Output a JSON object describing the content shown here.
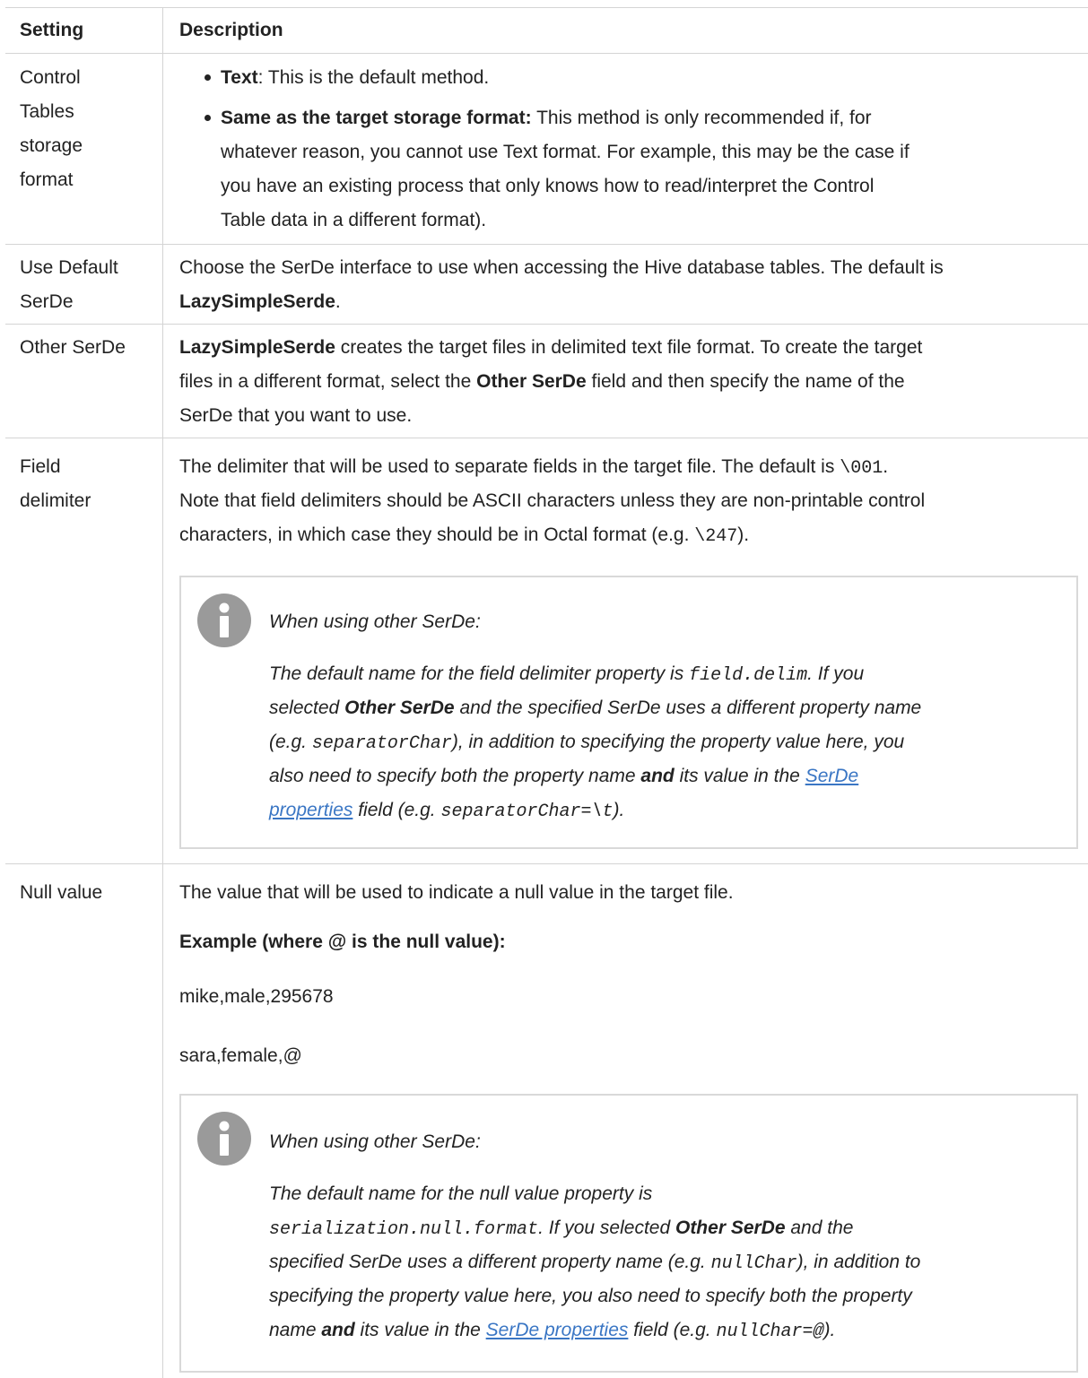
{
  "table": {
    "headers": {
      "setting": "Setting",
      "description": "Description"
    },
    "rows": {
      "control_tables": {
        "setting_lines": [
          "Control",
          "Tables",
          "storage",
          "format"
        ],
        "bullet1_bold": "Text",
        "bullet1_rest": ": This is the default method.",
        "bullet2_bold": "Same as the target storage format:",
        "bullet2_l1": " This method is only recommended if, for",
        "bullet2_l2": "whatever reason, you cannot use Text format. For example, this may be the case if",
        "bullet2_l3": "you have an existing process that only knows how to read/interpret the Control",
        "bullet2_l4": "Table data in a different format)."
      },
      "use_default_serde": {
        "setting_lines": [
          "Use Default",
          "SerDe"
        ],
        "line1": "Choose the SerDe interface to use when accessing the Hive database tables. The default is",
        "line2_bold": "LazySimpleSerde",
        "line2_rest": "."
      },
      "other_serde": {
        "setting": "Other SerDe",
        "l1_bold": "LazySimpleSerde",
        "l1_rest": " creates the target files in delimited text file format. To create the target",
        "l2_a": "files in a different format, select the ",
        "l2_bold": "Other SerDe",
        "l2_b": " field and then specify the name of the",
        "l3": "SerDe that you want to use."
      },
      "field_delimiter": {
        "setting_lines": [
          "Field",
          "delimiter"
        ],
        "l1_a": "The delimiter that will be used to separate fields in the target file. The default is ",
        "l1_code": "\\001",
        "l1_b": ".",
        "l2": "Note that field delimiters should be ASCII characters unless they are non-printable control",
        "l3_a": "characters, in which case they should be in Octal format (e.g. ",
        "l3_code": "\\247",
        "l3_b": ").",
        "note": {
          "heading": "When using other SerDe:",
          "l1_a": "The default name for the field delimiter property is ",
          "l1_code": "field.delim",
          "l1_b": ". If you",
          "l2_a": "selected ",
          "l2_bold": "Other SerDe",
          "l2_b": " and the specified SerDe uses a different property name",
          "l3_a": "(e.g. ",
          "l3_code": "separatorChar",
          "l3_b": "), in addition to specifying the property value here, you",
          "l4_a": "also need to specify both the property name ",
          "l4_bold": "and",
          "l4_b": " its value in the ",
          "l4_link": "SerDe",
          "l5_link": "properties",
          "l5_a": " field (e.g. ",
          "l5_code": "separatorChar=\\t",
          "l5_b": ")."
        }
      },
      "null_value": {
        "setting": "Null value",
        "l1": "The value that will be used to indicate a null value in the target file.",
        "example_heading": "Example (where @ is the null value):",
        "example1": "mike,male,295678",
        "example2": "sara,female,@",
        "note": {
          "heading": "When using other SerDe:",
          "l1": "The default name for the null value property is",
          "l2_code": "serialization.null.format",
          "l2_a": ". If you selected ",
          "l2_bold": "Other SerDe",
          "l2_b": " and the",
          "l3_a": "specified SerDe uses a different property name (e.g. ",
          "l3_code": "nullChar",
          "l3_b": "), in addition to",
          "l4": "specifying the property value here, you also need to specify both the property",
          "l5_a": "name ",
          "l5_bold": "and",
          "l5_b": " its value in the ",
          "l5_link": "SerDe properties",
          "l5_c": " field (e.g. ",
          "l5_code": "nullChar=@",
          "l5_d": ")."
        }
      }
    }
  },
  "colors": {
    "border": "#d4d4d4",
    "note_border": "#d9d9d9",
    "icon": "#9a9a9a",
    "link": "#3a76c4"
  }
}
